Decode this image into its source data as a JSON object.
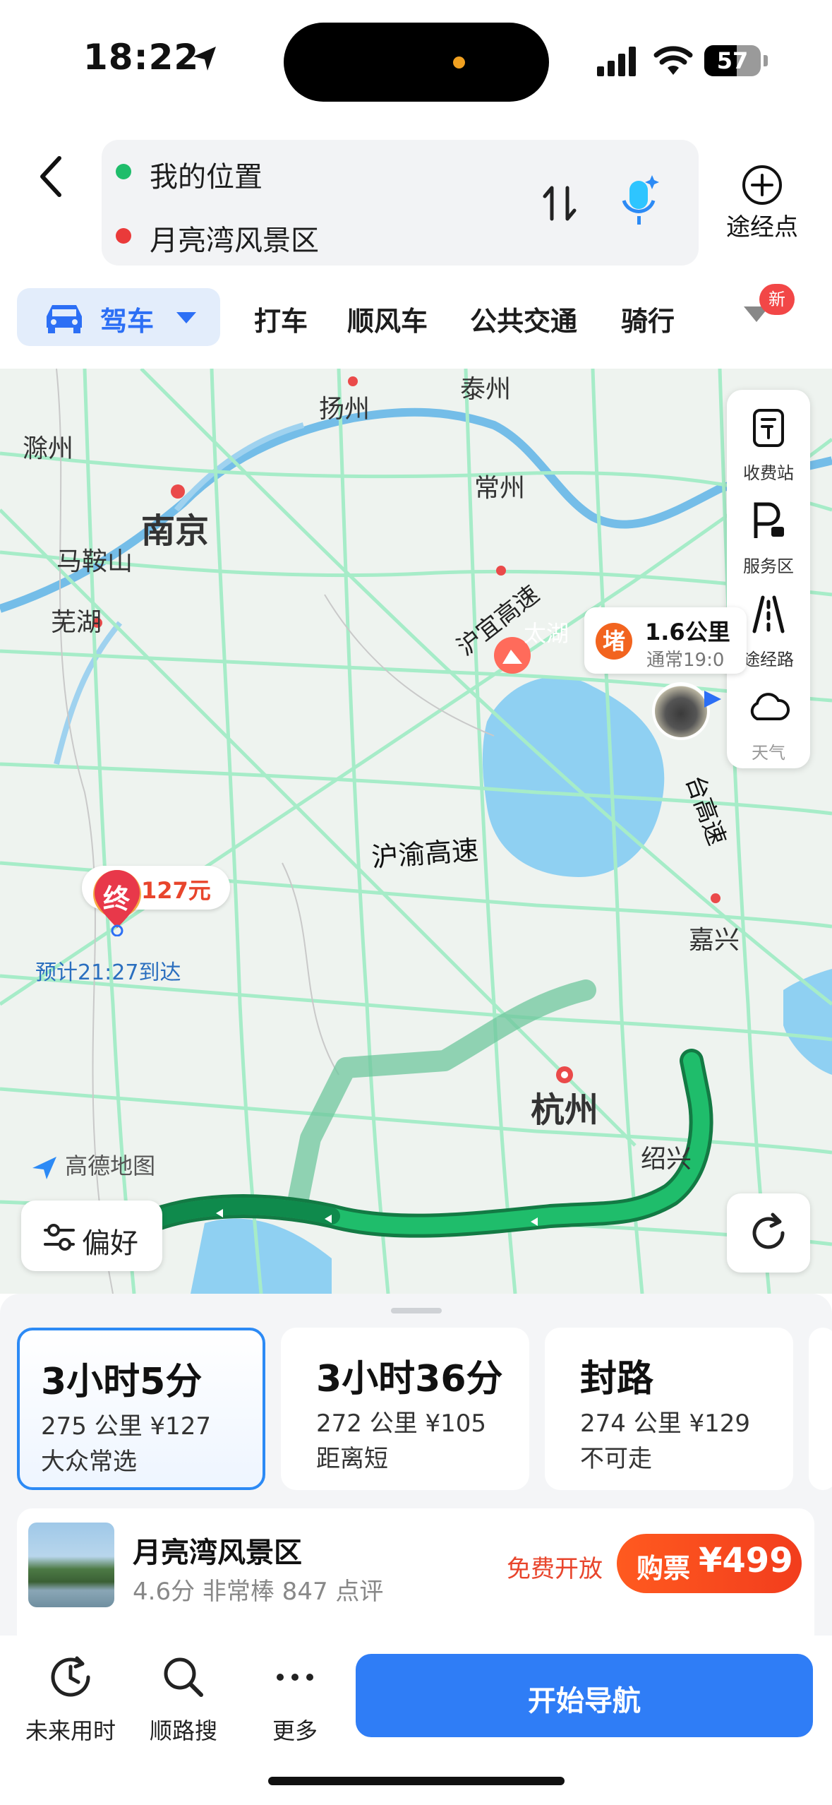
{
  "status_bar": {
    "time": "18:22",
    "battery": "57",
    "battery_level": 0.57
  },
  "header": {
    "start": "我的位置",
    "end": "月亮湾风景区",
    "waypoint_label": "途经点"
  },
  "modes": {
    "active": "驾车",
    "tabs": [
      "打车",
      "顺风车",
      "公共交通",
      "骑行"
    ],
    "new_badge": "新"
  },
  "map": {
    "cities": [
      "扬州",
      "泰州",
      "滁州",
      "南京",
      "常州",
      "马鞍山",
      "芜湖",
      "太湖",
      "嘉兴",
      "杭州",
      "绍兴"
    ],
    "roads": [
      "沪宜高速",
      "沪渝高速",
      "台高速"
    ],
    "side_panel": [
      "收费站",
      "服务区",
      "途经路",
      "天气"
    ],
    "jam": {
      "badge": "堵",
      "distance": "1.6公里",
      "sub": "通常19:0"
    },
    "toll": "127元",
    "end_pin": "终",
    "eta": "预计21:27到达",
    "logo": "高德地图",
    "preference": "偏好"
  },
  "routes": [
    {
      "time": "3小时5分",
      "info": "275 公里  ¥127",
      "tag": "大众常选"
    },
    {
      "time": "3小时36分",
      "info": "272 公里  ¥105",
      "tag": "距离短"
    },
    {
      "time": "封路",
      "info": "274 公里  ¥129",
      "tag": "不可走"
    }
  ],
  "poi": {
    "name": "月亮湾风景区",
    "meta": "4.6分  非常棒  847 点评",
    "free": "免费开放",
    "ticket_label": "购票",
    "ticket_price": "¥499"
  },
  "toolbar": {
    "future": "未来用时",
    "search_along": "顺路搜",
    "more": "更多",
    "start": "开始导航"
  },
  "colors": {
    "accent": "#2f7df6",
    "route_green": "#1fa868",
    "jam_orange": "#f2641f",
    "price_red": "#e8452c"
  }
}
